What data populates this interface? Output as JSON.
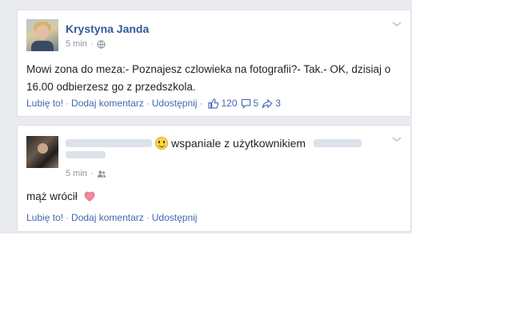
{
  "colors": {
    "link": "#4267b2",
    "author": "#365899",
    "muted": "#90949c",
    "text": "#1d2129",
    "heart": "#e66b7e"
  },
  "post1": {
    "author": "Krystyna Janda",
    "time": "5 min",
    "separator": "·",
    "text": "Mowi zona do meza:- Poznajesz czlowieka na fotografii?- Tak.- OK, dzisiaj o 16.00 odbierzesz go z przedszkola.",
    "actions": {
      "like": "Lubię to!",
      "comment": "Dodaj komentarz",
      "share": "Udostępnij"
    },
    "stats": {
      "likes": "120",
      "comments": "5",
      "shares": "3"
    },
    "icons": {
      "audience": "globe-icon",
      "menu": "chevron-down-icon",
      "like": "thumbs-up-icon",
      "comment": "comment-icon",
      "share": "share-icon"
    }
  },
  "post2": {
    "feeling": "wspaniale z użytkownikiem",
    "time": "5 min",
    "separator": "·",
    "text": "mąż wrócił",
    "actions": {
      "like": "Lubię to!",
      "comment": "Dodaj komentarz",
      "share": "Udostępnij"
    },
    "icons": {
      "emoji": "smiley-icon",
      "audience": "friends-icon",
      "menu": "chevron-down-icon",
      "heart": "heart-icon"
    }
  }
}
